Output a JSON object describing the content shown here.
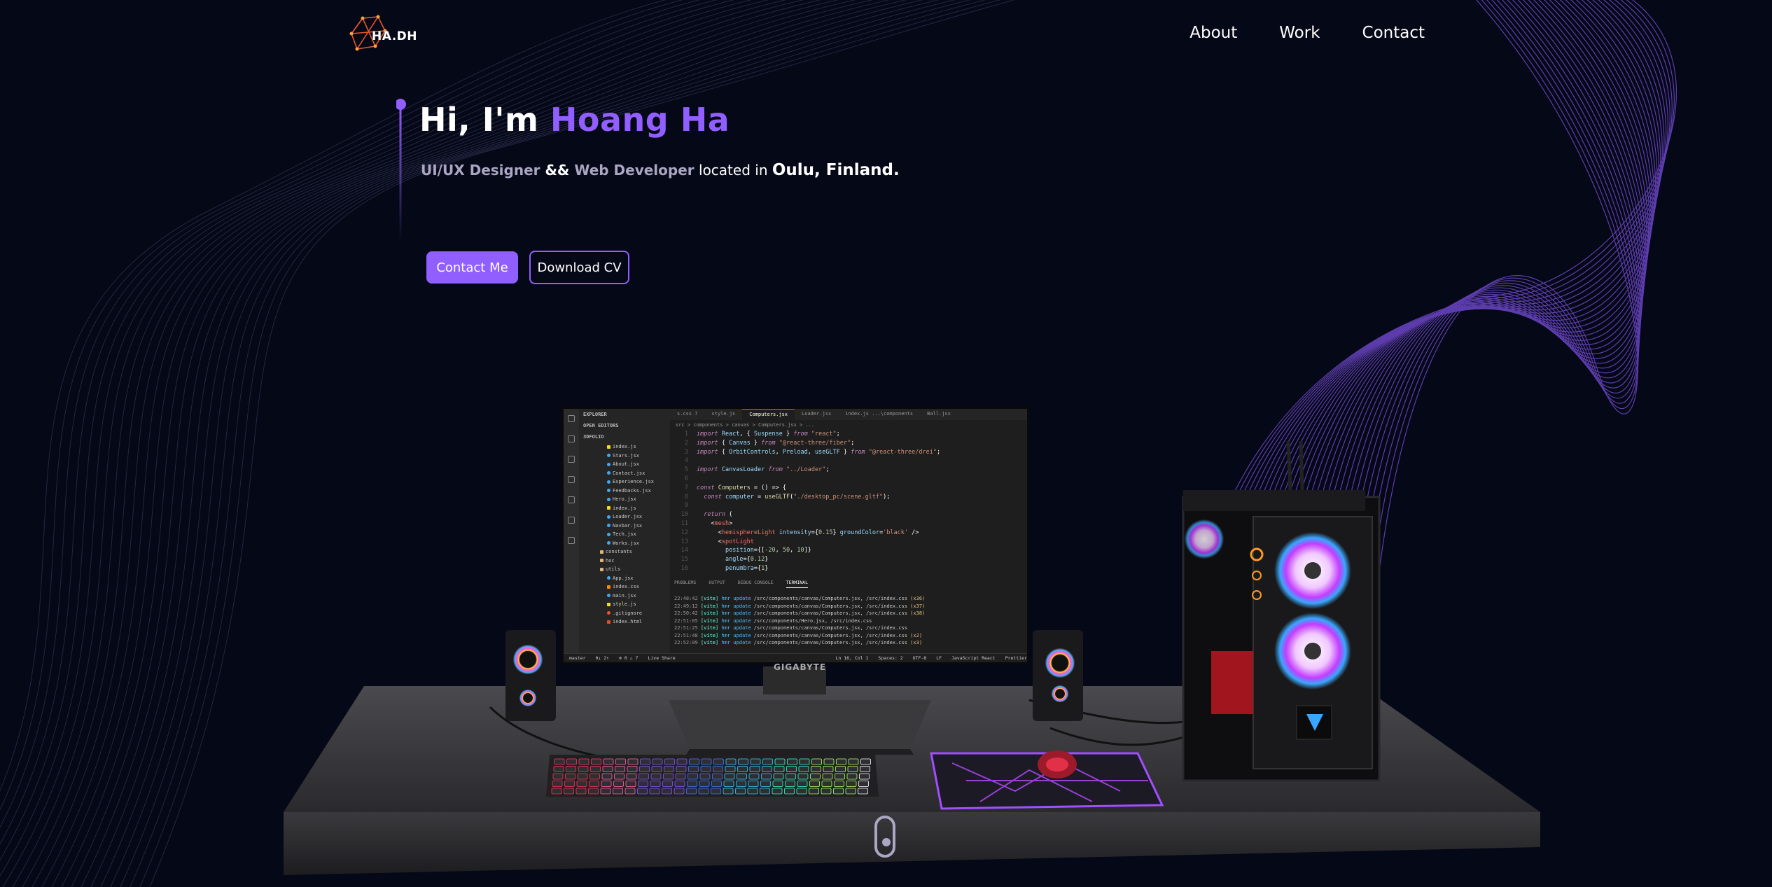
{
  "brand": {
    "logo_text": "HA.DH"
  },
  "nav": {
    "items": [
      "About",
      "Work",
      "Contact"
    ]
  },
  "hero": {
    "greeting": "Hi, I'm ",
    "name": "Hoang Ha",
    "role1": "UI/UX Designer",
    "amp": " && ",
    "role2": "Web Developer",
    "located": " located in ",
    "city": "Oulu, Finland.",
    "contact_button": "Contact Me",
    "cv_button": "Download CV"
  },
  "editor": {
    "explorer_title": "EXPLORER",
    "open_editors": "OPEN EDITORS",
    "project": "3DFOLIO",
    "files": [
      {
        "name": "index.js",
        "type": "js"
      },
      {
        "name": "Stars.jsx",
        "type": "jsx"
      },
      {
        "name": "About.jsx",
        "type": "jsx"
      },
      {
        "name": "Contact.jsx",
        "type": "jsx"
      },
      {
        "name": "Experience.jsx",
        "type": "jsx"
      },
      {
        "name": "Feedbacks.jsx",
        "type": "jsx"
      },
      {
        "name": "Hero.jsx",
        "type": "jsx"
      },
      {
        "name": "index.js",
        "type": "js"
      },
      {
        "name": "Loader.jsx",
        "type": "jsx"
      },
      {
        "name": "Navbar.jsx",
        "type": "jsx"
      },
      {
        "name": "Tech.jsx",
        "type": "jsx"
      },
      {
        "name": "Works.jsx",
        "type": "jsx"
      },
      {
        "name": "constants",
        "type": "dir"
      },
      {
        "name": "hoc",
        "type": "dir"
      },
      {
        "name": "utils",
        "type": "dir"
      },
      {
        "name": "App.jsx",
        "type": "jsx"
      },
      {
        "name": "index.css",
        "type": "css"
      },
      {
        "name": "main.jsx",
        "type": "jsx"
      },
      {
        "name": "style.js",
        "type": "js"
      },
      {
        "name": ".gitignore",
        "type": "git"
      },
      {
        "name": "index.html",
        "type": "html"
      }
    ],
    "tabs": [
      "s.css 7",
      "style.js",
      "Computers.jsx",
      "Loader.jsx",
      "index.js ...\\components",
      "Ball.jsx"
    ],
    "breadcrumb": "src > components > canvas > Computers.jsx > ...",
    "panel_tabs": [
      "PROBLEMS",
      "OUTPUT",
      "DEBUG CONSOLE",
      "TERMINAL"
    ],
    "terminal": [
      {
        "time": "22:48:42",
        "file": "/src/components/canvas/Computers.jsx, /src/index.css",
        "count": "(x36)"
      },
      {
        "time": "22:49:12",
        "file": "/src/components/canvas/Computers.jsx, /src/index.css",
        "count": "(x37)"
      },
      {
        "time": "22:50:42",
        "file": "/src/components/canvas/Computers.jsx, /src/index.css",
        "count": "(x38)"
      },
      {
        "time": "22:51:05",
        "file": "/src/components/Hero.jsx, /src/index.css",
        "count": ""
      },
      {
        "time": "22:51:25",
        "file": "/src/components/canvas/Computers.jsx, /src/index.css",
        "count": ""
      },
      {
        "time": "22:51:48",
        "file": "/src/components/canvas/Computers.jsx, /src/index.css",
        "count": "(x2)"
      },
      {
        "time": "22:52:09",
        "file": "/src/components/canvas/Computers.jsx, /src/index.css",
        "count": "(x3)"
      }
    ],
    "status_left": [
      "master",
      "0↓ 2↑",
      "⊗ 0 ⚠ 7",
      "Live Share"
    ],
    "status_right": [
      "Ln 16, Col 1",
      "Spaces: 2",
      "UTF-8",
      "LF",
      "JavaScript React",
      "Prettier"
    ],
    "monitor_brand": "GIGABYTE"
  },
  "colors": {
    "accent": "#915eff",
    "background": "#050816",
    "muted": "#aaa6c3"
  }
}
